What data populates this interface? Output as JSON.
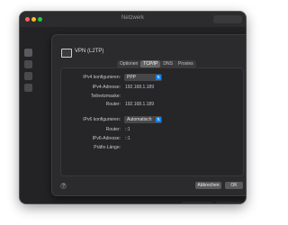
{
  "window": {
    "title": "Netzwerk"
  },
  "service": {
    "name": "VPN (L2TP)"
  },
  "tabs": [
    {
      "label": "Optionen",
      "selected": false
    },
    {
      "label": "TCP/IP",
      "selected": true
    },
    {
      "label": "DNS",
      "selected": false
    },
    {
      "label": "Proxies",
      "selected": false
    }
  ],
  "ipv4": {
    "configure_label": "IPv4 konfigurieren:",
    "configure_value": "PPP",
    "address_label": "IPv4-Adresse:",
    "address_value": "192.168.1.189",
    "subnet_label": "Teilnetzmaske:",
    "router_label": "Router:",
    "router_value": "192.168.1.189"
  },
  "ipv6": {
    "configure_label": "IPv6 konfigurieren:",
    "configure_value": "Automatisch",
    "router_label": "Router:",
    "router_value": "::1",
    "address_label": "IPv6-Adresse:",
    "address_value": "::1",
    "prefix_label": "Präfix-Länge:"
  },
  "buttons": {
    "help": "?",
    "cancel": "Abbrechen",
    "ok": "OK"
  },
  "colors": {
    "accent": "#0a84ff",
    "window_bg": "#232325",
    "sheet_bg": "#2b2b2d"
  }
}
